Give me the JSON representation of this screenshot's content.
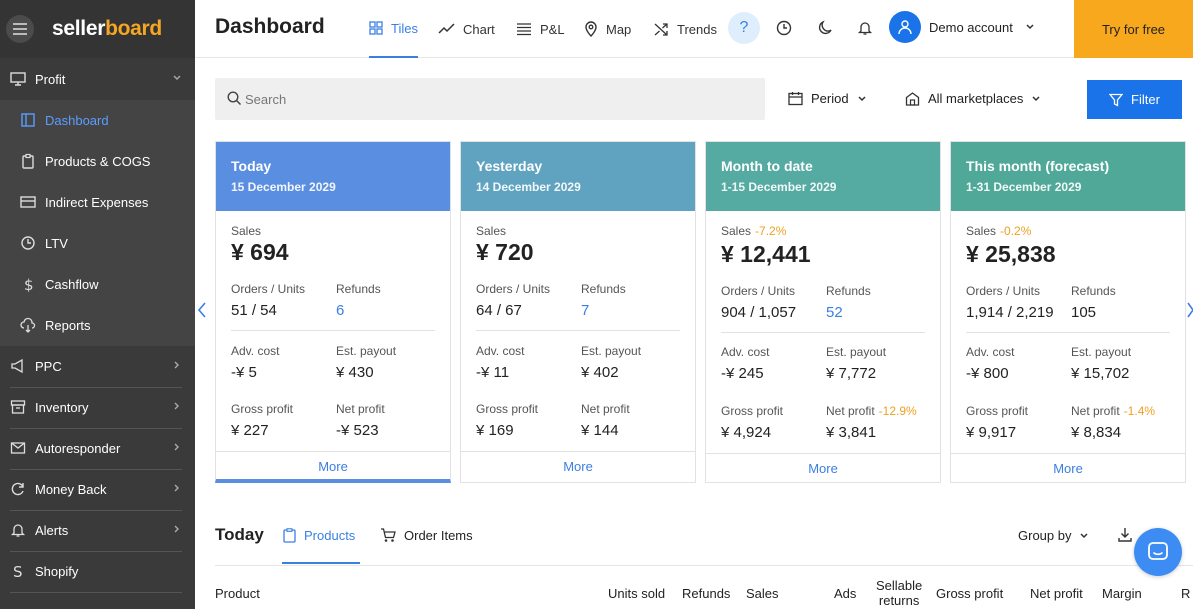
{
  "app": {
    "logo_part1": "seller",
    "logo_part2": "board"
  },
  "sidebar": {
    "items": [
      {
        "label": "Profit",
        "icon": "monitor-icon"
      },
      {
        "label": "Dashboard",
        "icon": "dashboard-icon"
      },
      {
        "label": "Products & COGS",
        "icon": "clipboard-icon"
      },
      {
        "label": "Indirect Expenses",
        "icon": "card-icon"
      },
      {
        "label": "LTV",
        "icon": "clock-icon"
      },
      {
        "label": "Cashflow",
        "icon": "dollar-icon"
      },
      {
        "label": "Reports",
        "icon": "cloud-download-icon"
      },
      {
        "label": "PPC",
        "icon": "megaphone-icon"
      },
      {
        "label": "Inventory",
        "icon": "box-icon"
      },
      {
        "label": "Autoresponder",
        "icon": "mail-icon"
      },
      {
        "label": "Money Back",
        "icon": "refresh-icon"
      },
      {
        "label": "Alerts",
        "icon": "bell-icon"
      },
      {
        "label": "Shopify",
        "icon": "shopify-icon"
      }
    ]
  },
  "header": {
    "title": "Dashboard",
    "tabs": [
      {
        "label": "Tiles",
        "icon": "grid-icon"
      },
      {
        "label": "Chart",
        "icon": "chart-line-icon"
      },
      {
        "label": "P&L",
        "icon": "list-icon"
      },
      {
        "label": "Map",
        "icon": "map-pin-icon"
      },
      {
        "label": "Trends",
        "icon": "shuffle-icon"
      }
    ],
    "help_label": "?",
    "account": "Demo account",
    "try_label": "Try for free"
  },
  "toolbar": {
    "search_placeholder": "Search",
    "period_label": "Period",
    "marketplaces_label": "All marketplaces",
    "filter_label": "Filter"
  },
  "colors": {
    "today": "#5a8ee0",
    "yesterday": "#5fa3c0",
    "month": "#55aaa2",
    "forecast": "#50a898",
    "accent": "#1a73e8",
    "brand_orange": "#f8a81d"
  },
  "cards": [
    {
      "title": "Today",
      "date": "15 December 2029",
      "sales_label": "Sales",
      "sales_change": "",
      "sales": "¥ 694",
      "orders_label": "Orders / Units",
      "orders": "51 / 54",
      "refunds_label": "Refunds",
      "refunds": "6",
      "adv_label": "Adv. cost",
      "adv": "-¥ 5",
      "payout_label": "Est. payout",
      "payout": "¥ 430",
      "gross_label": "Gross profit",
      "gross": "¥ 227",
      "net_label": "Net profit",
      "net_change": "",
      "net": "-¥ 523",
      "more": "More"
    },
    {
      "title": "Yesterday",
      "date": "14 December 2029",
      "sales_label": "Sales",
      "sales_change": "",
      "sales": "¥ 720",
      "orders_label": "Orders / Units",
      "orders": "64 / 67",
      "refunds_label": "Refunds",
      "refunds": "7",
      "adv_label": "Adv. cost",
      "adv": "-¥ 11",
      "payout_label": "Est. payout",
      "payout": "¥ 402",
      "gross_label": "Gross profit",
      "gross": "¥ 169",
      "net_label": "Net profit",
      "net_change": "",
      "net": "¥ 144",
      "more": "More"
    },
    {
      "title": "Month to date",
      "date": "1-15 December 2029",
      "sales_label": "Sales",
      "sales_change": "-7.2%",
      "sales": "¥ 12,441",
      "orders_label": "Orders / Units",
      "orders": "904 / 1,057",
      "refunds_label": "Refunds",
      "refunds": "52",
      "adv_label": "Adv. cost",
      "adv": "-¥ 245",
      "payout_label": "Est. payout",
      "payout": "¥ 7,772",
      "gross_label": "Gross profit",
      "gross": "¥ 4,924",
      "net_label": "Net profit",
      "net_change": "-12.9%",
      "net": "¥ 3,841",
      "more": "More"
    },
    {
      "title": "This month (forecast)",
      "date": "1-31 December 2029",
      "sales_label": "Sales",
      "sales_change": "-0.2%",
      "sales": "¥ 25,838",
      "orders_label": "Orders / Units",
      "orders": "1,914 / 2,219",
      "refunds_label": "Refunds",
      "refunds": "105",
      "adv_label": "Adv. cost",
      "adv": "-¥ 800",
      "payout_label": "Est. payout",
      "payout": "¥ 15,702",
      "gross_label": "Gross profit",
      "gross": "¥ 9,917",
      "net_label": "Net profit",
      "net_change": "-1.4%",
      "net": "¥ 8,834",
      "more": "More"
    }
  ],
  "bottom": {
    "title": "Today",
    "tabs": [
      {
        "label": "Products"
      },
      {
        "label": "Order Items"
      }
    ],
    "group_by": "Group by",
    "columns": [
      "Product",
      "Units sold",
      "Refunds",
      "Sales",
      "Ads",
      "Sellable",
      "returns",
      "Gross profit",
      "Net profit",
      "Margin",
      "R"
    ]
  }
}
